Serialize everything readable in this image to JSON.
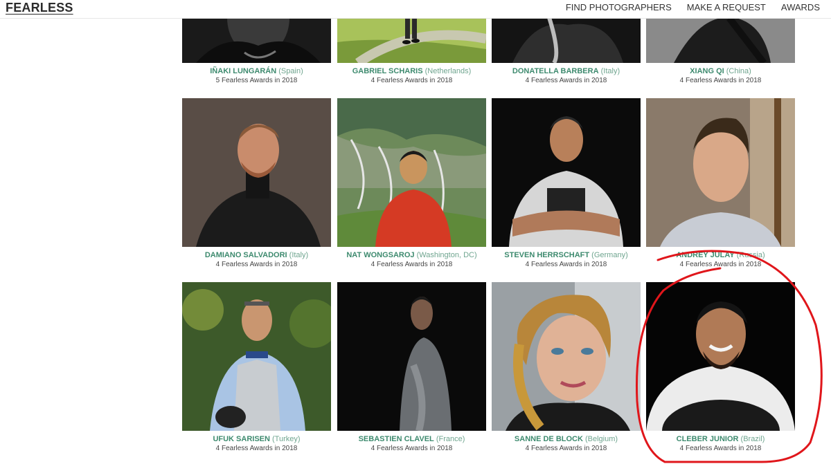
{
  "header": {
    "logo": "FEARLESS",
    "nav": [
      {
        "label": "FIND PHOTOGRAPHERS"
      },
      {
        "label": "MAKE A REQUEST"
      },
      {
        "label": "AWARDS"
      }
    ]
  },
  "colors": {
    "accent_green": "#3d8a6e",
    "annotation_red": "#e0161b"
  },
  "photographers": [
    {
      "name": "IÑAKI LUNGARÁN",
      "country": "(Spain)",
      "awards": "5 Fearless Awards in 2018"
    },
    {
      "name": "GABRIEL SCHARIS",
      "country": "(Netherlands)",
      "awards": "4 Fearless Awards in 2018"
    },
    {
      "name": "DONATELLA BARBERA",
      "country": "(Italy)",
      "awards": "4 Fearless Awards in 2018"
    },
    {
      "name": "XIANG QI",
      "country": "(China)",
      "awards": "4 Fearless Awards in 2018"
    },
    {
      "name": "DAMIANO SALVADORI",
      "country": "(Italy)",
      "awards": "4 Fearless Awards in 2018"
    },
    {
      "name": "NAT WONGSAROJ",
      "country": "(Washington, DC)",
      "awards": "4 Fearless Awards in 2018"
    },
    {
      "name": "STEVEN HERRSCHAFT",
      "country": "(Germany)",
      "awards": "4 Fearless Awards in 2018"
    },
    {
      "name": "ANDREY JULAY",
      "country": "(Russia)",
      "awards": "4 Fearless Awards in 2018"
    },
    {
      "name": "UFUK SARISEN",
      "country": "(Turkey)",
      "awards": "4 Fearless Awards in 2018"
    },
    {
      "name": "SEBASTIEN CLAVEL",
      "country": "(France)",
      "awards": "4 Fearless Awards in 2018"
    },
    {
      "name": "SANNE DE BLOCK",
      "country": "(Belgium)",
      "awards": "4 Fearless Awards in 2018"
    },
    {
      "name": "CLEBER JUNIOR",
      "country": "(Brazil)",
      "awards": "4 Fearless Awards in 2018"
    }
  ]
}
